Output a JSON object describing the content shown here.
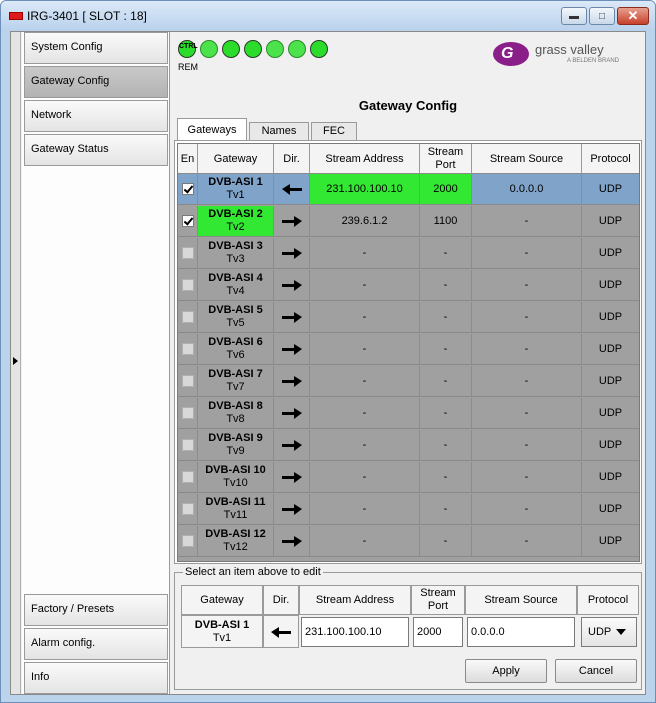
{
  "window": {
    "title": "IRG-3401 [ SLOT : 18]"
  },
  "nav": {
    "top": [
      {
        "key": "system-config",
        "label": "System Config",
        "active": false
      },
      {
        "key": "gateway-config",
        "label": "Gateway Config",
        "active": true
      },
      {
        "key": "network",
        "label": "Network",
        "active": false
      },
      {
        "key": "gateway-status",
        "label": "Gateway Status",
        "active": false
      }
    ],
    "bottom": [
      {
        "key": "factory-presets",
        "label": "Factory / Presets"
      },
      {
        "key": "alarm-config",
        "label": "Alarm config."
      },
      {
        "key": "info",
        "label": "Info"
      }
    ]
  },
  "toolbar": {
    "ctrl_label": "CTRL",
    "rem_label": "REM",
    "brand": {
      "name": "grass valley",
      "sub": "A BELDEN BRAND",
      "color": "#8a1f8a"
    },
    "status_icons": [
      "ctrl-icon",
      "eye-icon",
      "network-icon",
      "network-icon",
      "export-icon",
      "export-icon",
      "plus-icon"
    ]
  },
  "page": {
    "title": "Gateway Config"
  },
  "tabs": [
    {
      "label": "Gateways",
      "active": true
    },
    {
      "label": "Names",
      "active": false
    },
    {
      "label": "FEC",
      "active": false
    }
  ],
  "table": {
    "columns": [
      "En",
      "Gateway",
      "Dir.",
      "Stream Address",
      "Stream Port",
      "Stream Source",
      "Protocol"
    ],
    "rows": [
      {
        "enabled": true,
        "name": "DVB-ASI 1",
        "sub": "Tv1",
        "dir": "left",
        "address": "231.100.100.10",
        "port": "2000",
        "source": "0.0.0.0",
        "protocol": "UDP",
        "selected": true,
        "highlight": "address"
      },
      {
        "enabled": true,
        "name": "DVB-ASI 2",
        "sub": "Tv2",
        "dir": "right",
        "address": "239.6.1.2",
        "port": "1100",
        "source": "-",
        "protocol": "UDP",
        "selected": false,
        "highlight": "gateway"
      },
      {
        "enabled": false,
        "name": "DVB-ASI 3",
        "sub": "Tv3",
        "dir": "right",
        "address": "-",
        "port": "-",
        "source": "-",
        "protocol": "UDP"
      },
      {
        "enabled": false,
        "name": "DVB-ASI 4",
        "sub": "Tv4",
        "dir": "right",
        "address": "-",
        "port": "-",
        "source": "-",
        "protocol": "UDP"
      },
      {
        "enabled": false,
        "name": "DVB-ASI 5",
        "sub": "Tv5",
        "dir": "right",
        "address": "-",
        "port": "-",
        "source": "-",
        "protocol": "UDP"
      },
      {
        "enabled": false,
        "name": "DVB-ASI 6",
        "sub": "Tv6",
        "dir": "right",
        "address": "-",
        "port": "-",
        "source": "-",
        "protocol": "UDP"
      },
      {
        "enabled": false,
        "name": "DVB-ASI 7",
        "sub": "Tv7",
        "dir": "right",
        "address": "-",
        "port": "-",
        "source": "-",
        "protocol": "UDP"
      },
      {
        "enabled": false,
        "name": "DVB-ASI 8",
        "sub": "Tv8",
        "dir": "right",
        "address": "-",
        "port": "-",
        "source": "-",
        "protocol": "UDP"
      },
      {
        "enabled": false,
        "name": "DVB-ASI 9",
        "sub": "Tv9",
        "dir": "right",
        "address": "-",
        "port": "-",
        "source": "-",
        "protocol": "UDP"
      },
      {
        "enabled": false,
        "name": "DVB-ASI 10",
        "sub": "Tv10",
        "dir": "right",
        "address": "-",
        "port": "-",
        "source": "-",
        "protocol": "UDP"
      },
      {
        "enabled": false,
        "name": "DVB-ASI 11",
        "sub": "Tv11",
        "dir": "right",
        "address": "-",
        "port": "-",
        "source": "-",
        "protocol": "UDP"
      },
      {
        "enabled": false,
        "name": "DVB-ASI 12",
        "sub": "Tv12",
        "dir": "right",
        "address": "-",
        "port": "-",
        "source": "-",
        "protocol": "UDP"
      }
    ]
  },
  "editor": {
    "legend": "Select an item above to edit",
    "columns": [
      "Gateway",
      "Dir.",
      "Stream Address",
      "Stream Port",
      "Stream Source",
      "Protocol"
    ],
    "gateway_name": "DVB-ASI 1",
    "gateway_sub": "Tv1",
    "dir": "left",
    "address": "231.100.100.10",
    "port": "2000",
    "source": "0.0.0.0",
    "protocol": "UDP",
    "apply_label": "Apply",
    "cancel_label": "Cancel"
  },
  "colors": {
    "selected_row": "#7fa3c9",
    "highlight": "#33e833",
    "grid_bg": "#a0a0a0"
  }
}
